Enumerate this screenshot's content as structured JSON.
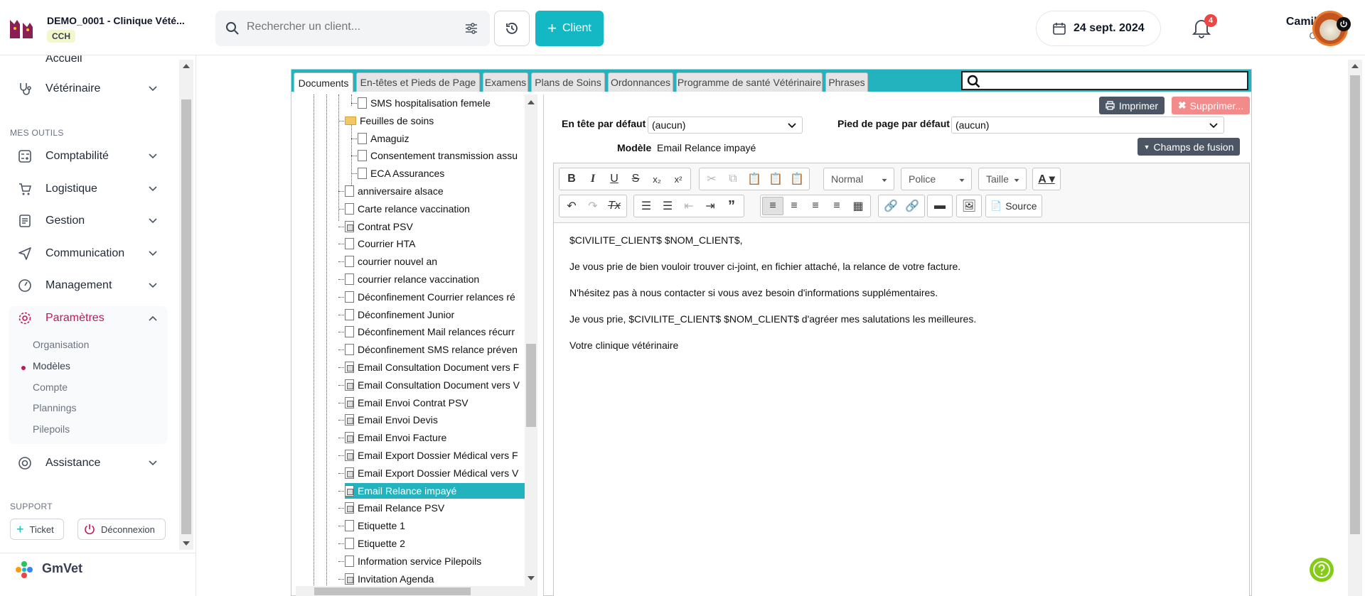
{
  "clinic": {
    "name": "DEMO_0001 - Clinique Vété...",
    "badge": "CCH"
  },
  "nav": {
    "accueil": "Accueil",
    "veterinaire": "Vétérinaire",
    "mes_outils": "MES OUTILS",
    "comptabilite": "Comptabilité",
    "logistique": "Logistique",
    "gestion": "Gestion",
    "communication": "Communication",
    "management": "Management",
    "parametres": "Paramètres",
    "sub": [
      "Organisation",
      "Modèles",
      "Compte",
      "Plannings",
      "Pilepoils"
    ],
    "assistance": "Assistance",
    "support": "SUPPORT",
    "ticket": "Ticket",
    "deconnexion": "Déconnexion",
    "brand": "GmVet"
  },
  "topbar": {
    "search_placeholder": "Rechercher un client...",
    "client_btn": "Client",
    "date": "24 sept. 2024",
    "notifications": "4",
    "user_name": "Camille M.",
    "user_sub": "Camille"
  },
  "tabs": [
    "Documents",
    "En-têtes et Pieds de Page",
    "Examens",
    "Plans de Soins",
    "Ordonnances",
    "Programme de santé Vétérinaire",
    "Phrases"
  ],
  "tree": {
    "items": [
      "SMS hospitalisation femele",
      "Feuilles de soins",
      "Amaguiz",
      "Consentement transmission assu",
      "ECA Assurances",
      "anniversaire alsace",
      "Carte relance vaccination",
      "Contrat PSV",
      "Courrier HTA",
      "courrier nouvel an",
      "courrier relance vaccination",
      "Déconfinement Courrier relances ré",
      "Déconfinement Junior",
      "Déconfinement Mail relances récurr",
      "Déconfinement SMS relance préven",
      "Email Consultation Document vers F",
      "Email Consultation Document vers V",
      "Email Envoi Contrat PSV",
      "Email Envoi Devis",
      "Email Envoi Facture",
      "Email Export Dossier Médical vers F",
      "Email Export Dossier Médical vers V",
      "Email Relance impayé",
      "Email Relance PSV",
      "Etiquette 1",
      "Etiquette 2",
      "Information service Pilepoils",
      "Invitation Agenda"
    ]
  },
  "panel": {
    "print": "Imprimer",
    "delete": "Supprimer...",
    "header_label": "En tête par défaut",
    "header_value": "(aucun)",
    "footer_label": "Pied de page par défaut",
    "footer_value": "(aucun)",
    "model_label": "Modèle",
    "model_value": "Email Relance impayé",
    "fusion": "Champs de fusion"
  },
  "toolbar": {
    "format": "Normal",
    "font": "Police",
    "size": "Taille",
    "source": "Source"
  },
  "content": [
    "$CIVILITE_CLIENT$ $NOM_CLIENT$,",
    "Je vous prie de bien vouloir trouver ci-joint, en fichier attaché, la relance de votre facture.",
    "N'hésitez pas à nous contacter si vous avez besoin d'informations supplémentaires.",
    "Je vous prie, $CIVILITE_CLIENT$ $NOM_CLIENT$ d'agréer mes salutations les meilleures.",
    "Votre clinique vétérinaire"
  ],
  "colors": {
    "accent": "#14b8c4",
    "tab_bar": "#22b3bf",
    "active_nav": "#be185d",
    "dark_btn": "#4b5563",
    "danger": "#f38b8b"
  }
}
